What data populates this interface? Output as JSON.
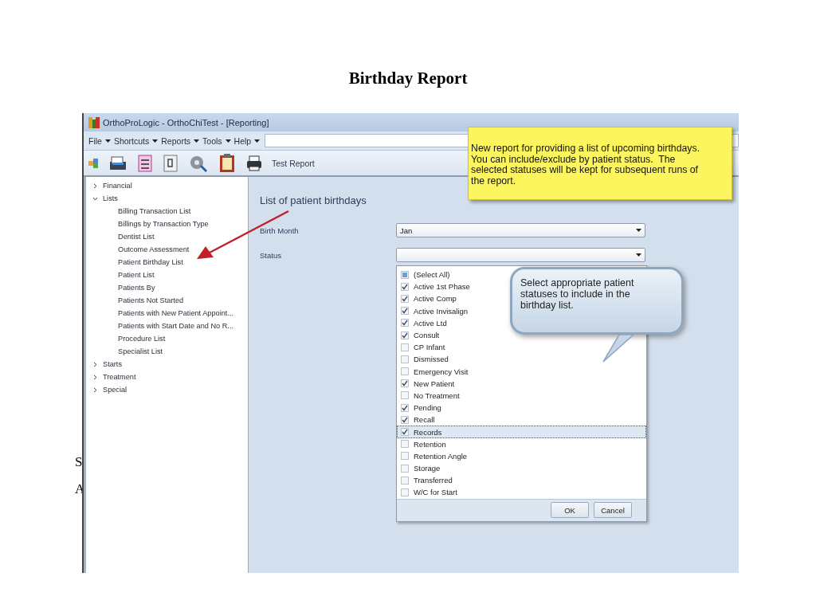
{
  "page_title": "Birthday Report",
  "slide_fragments": [
    "S",
    "A"
  ],
  "window": {
    "title": "OrthoProLogic - OrthoChiTest - [Reporting]"
  },
  "menu": [
    "File",
    "Shortcuts",
    "Reports",
    "Tools",
    "Help"
  ],
  "toolbar": {
    "report_name": "Test Report"
  },
  "tree": [
    {
      "label": "Financial",
      "expanded": false
    },
    {
      "label": "Lists",
      "expanded": true,
      "children": [
        {
          "label": "Billing Transaction List"
        },
        {
          "label": "Billings by Transaction Type"
        },
        {
          "label": "Dentist List"
        },
        {
          "label": "Outcome Assessment"
        },
        {
          "label": "Patient Birthday List"
        },
        {
          "label": "Patient List"
        },
        {
          "label": "Patients By"
        },
        {
          "label": "Patients Not Started"
        },
        {
          "label": "Patients with New Patient Appoint..."
        },
        {
          "label": "Patients with Start Date and No R..."
        },
        {
          "label": "Procedure List"
        },
        {
          "label": "Specialist List"
        }
      ]
    },
    {
      "label": "Starts",
      "expanded": false
    },
    {
      "label": "Treatment",
      "expanded": false
    },
    {
      "label": "Special",
      "expanded": false
    }
  ],
  "report": {
    "heading": "List of patient birthdays",
    "birth_month": {
      "label": "Birth Month",
      "value": "Jan"
    },
    "status": {
      "label": "Status"
    }
  },
  "status_options": [
    {
      "kind": "partial",
      "label": "(Select All)",
      "checked": false,
      "focused": false
    },
    {
      "kind": "option",
      "label": "Active 1st Phase",
      "checked": true,
      "focused": false
    },
    {
      "kind": "option",
      "label": "Active Comp",
      "checked": true,
      "focused": false
    },
    {
      "kind": "option",
      "label": "Active Invisalign",
      "checked": true,
      "focused": false
    },
    {
      "kind": "option",
      "label": "Active Ltd",
      "checked": true,
      "focused": false
    },
    {
      "kind": "option",
      "label": "Consult",
      "checked": true,
      "focused": false
    },
    {
      "kind": "option",
      "label": "CP Infant",
      "checked": false,
      "focused": false
    },
    {
      "kind": "option",
      "label": "Dismissed",
      "checked": false,
      "focused": false
    },
    {
      "kind": "option",
      "label": "Emergency Visit",
      "checked": false,
      "focused": false
    },
    {
      "kind": "option",
      "label": "New Patient",
      "checked": true,
      "focused": false
    },
    {
      "kind": "option",
      "label": "No Treatment",
      "checked": false,
      "focused": false
    },
    {
      "kind": "option",
      "label": "Pending",
      "checked": true,
      "focused": false
    },
    {
      "kind": "option",
      "label": "Recall",
      "checked": true,
      "focused": false
    },
    {
      "kind": "option",
      "label": "Records",
      "checked": true,
      "focused": true
    },
    {
      "kind": "option",
      "label": "Retention",
      "checked": false,
      "focused": false
    },
    {
      "kind": "option",
      "label": "Retention Angle",
      "checked": false,
      "focused": false
    },
    {
      "kind": "option",
      "label": "Storage",
      "checked": false,
      "focused": false
    },
    {
      "kind": "option",
      "label": "Transferred",
      "checked": false,
      "focused": false
    },
    {
      "kind": "option",
      "label": "W/C for Start",
      "checked": false,
      "focused": false
    }
  ],
  "dropdown_buttons": [
    "OK",
    "Cancel"
  ],
  "note_lines": [
    "New report for providing a list of upcoming birthdays.",
    "You can include/exclude by patient status.  The",
    "selected statuses will be kept for subsequent runs of",
    "the report."
  ],
  "callout_lines": [
    "Select appropriate patient",
    "statuses to include in the",
    "birthday list."
  ]
}
